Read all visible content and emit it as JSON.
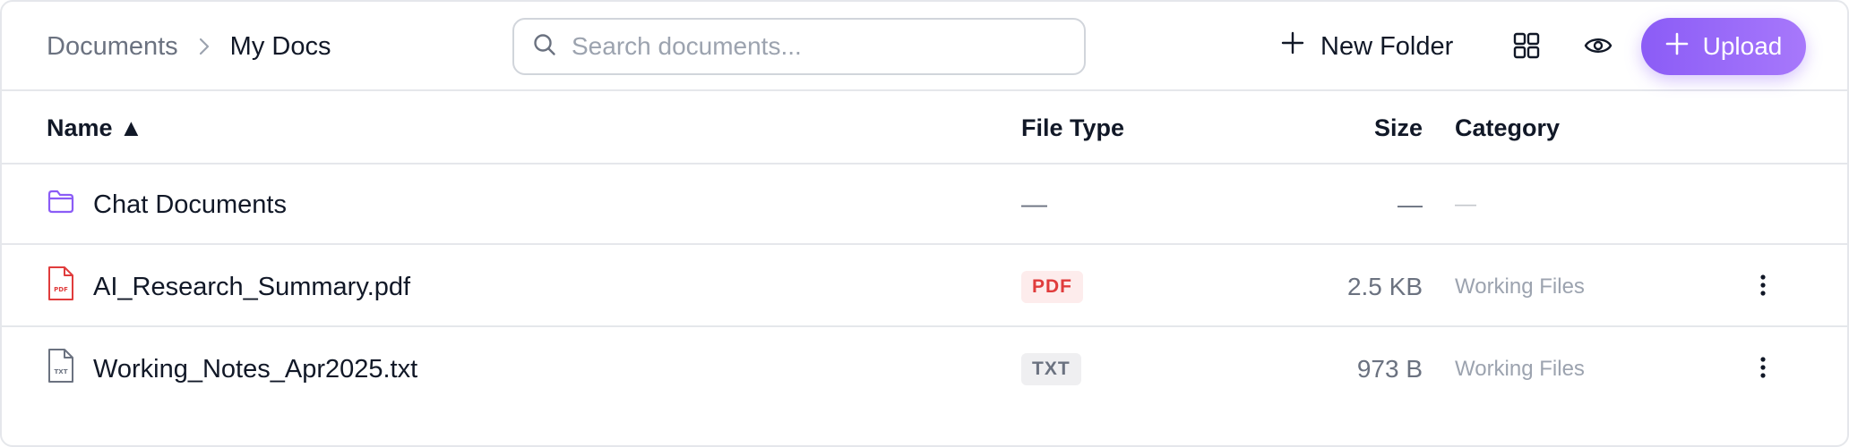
{
  "breadcrumb": {
    "root": "Documents",
    "current": "My Docs",
    "separator_icon": "chevron-right-icon"
  },
  "search": {
    "placeholder": "Search documents...",
    "value": ""
  },
  "toolbar": {
    "new_folder_label": "New Folder",
    "upload_label": "Upload",
    "accent_color": "#8b5cf6"
  },
  "table": {
    "columns": {
      "name": "Name ▲",
      "type": "File Type",
      "size": "Size",
      "category": "Category"
    },
    "rows": [
      {
        "icon": "folder-icon",
        "name": "Chat Documents",
        "type": "—",
        "size": "—",
        "category": "—"
      },
      {
        "icon": "pdf-file-icon",
        "name": "AI_Research_Summary.pdf",
        "type": "PDF",
        "size": "2.5 KB",
        "category": "Working Files"
      },
      {
        "icon": "txt-file-icon",
        "name": "Working_Notes_Apr2025.txt",
        "type": "TXT",
        "size": "973 B",
        "category": "Working Files"
      }
    ]
  }
}
